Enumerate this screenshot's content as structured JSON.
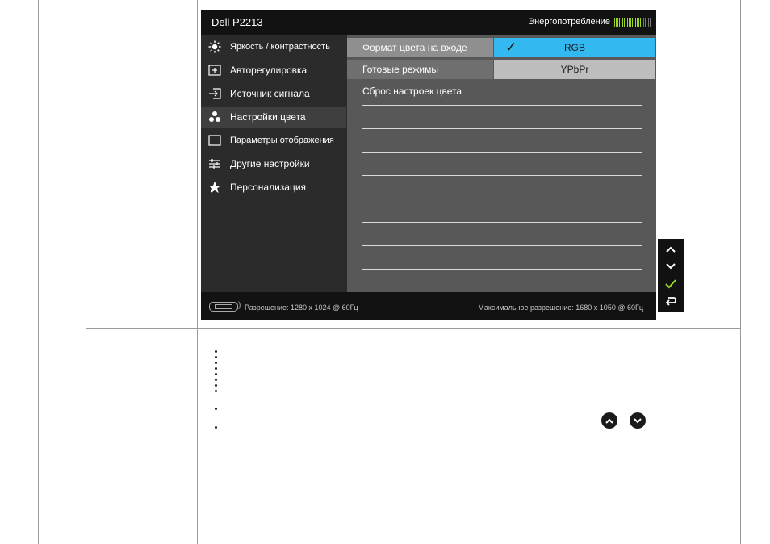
{
  "osd": {
    "title": "Dell P2213",
    "power_label": "Энергопотребление",
    "menu": [
      {
        "icon": "brightness-icon",
        "label": "Яркость / контрастность"
      },
      {
        "icon": "auto-adjust-icon",
        "label": "Авторегулировка"
      },
      {
        "icon": "input-source-icon",
        "label": "Источник сигнала"
      },
      {
        "icon": "color-settings-icon",
        "label": "Настройки цвета"
      },
      {
        "icon": "display-settings-icon",
        "label": "Параметры отображения"
      },
      {
        "icon": "other-settings-icon",
        "label": "Другие настройки"
      },
      {
        "icon": "star-icon",
        "label": "Персонализация"
      }
    ],
    "active_menu": "Настройки цвета",
    "submenu": [
      {
        "label": "Формат цвета на входе"
      },
      {
        "label": "Готовые режимы"
      },
      {
        "label": "Сброс настроек цвета"
      }
    ],
    "options": [
      {
        "label": "RGB",
        "selected": true
      },
      {
        "label": "YPbPr",
        "selected": false
      }
    ],
    "footer": {
      "resolution": "Разрешение: 1280 x 1024 @ 60Гц",
      "max_resolution": "Максимальное разрешение: 1680 x 1050 @ 60Гц"
    },
    "colors": {
      "highlight": "#33b8f0",
      "power_bar": "#9bd52a"
    }
  },
  "side_controls": [
    "up-arrow-icon",
    "down-arrow-icon",
    "check-icon",
    "back-icon"
  ],
  "round_buttons": [
    "up-round-icon",
    "down-round-icon"
  ]
}
